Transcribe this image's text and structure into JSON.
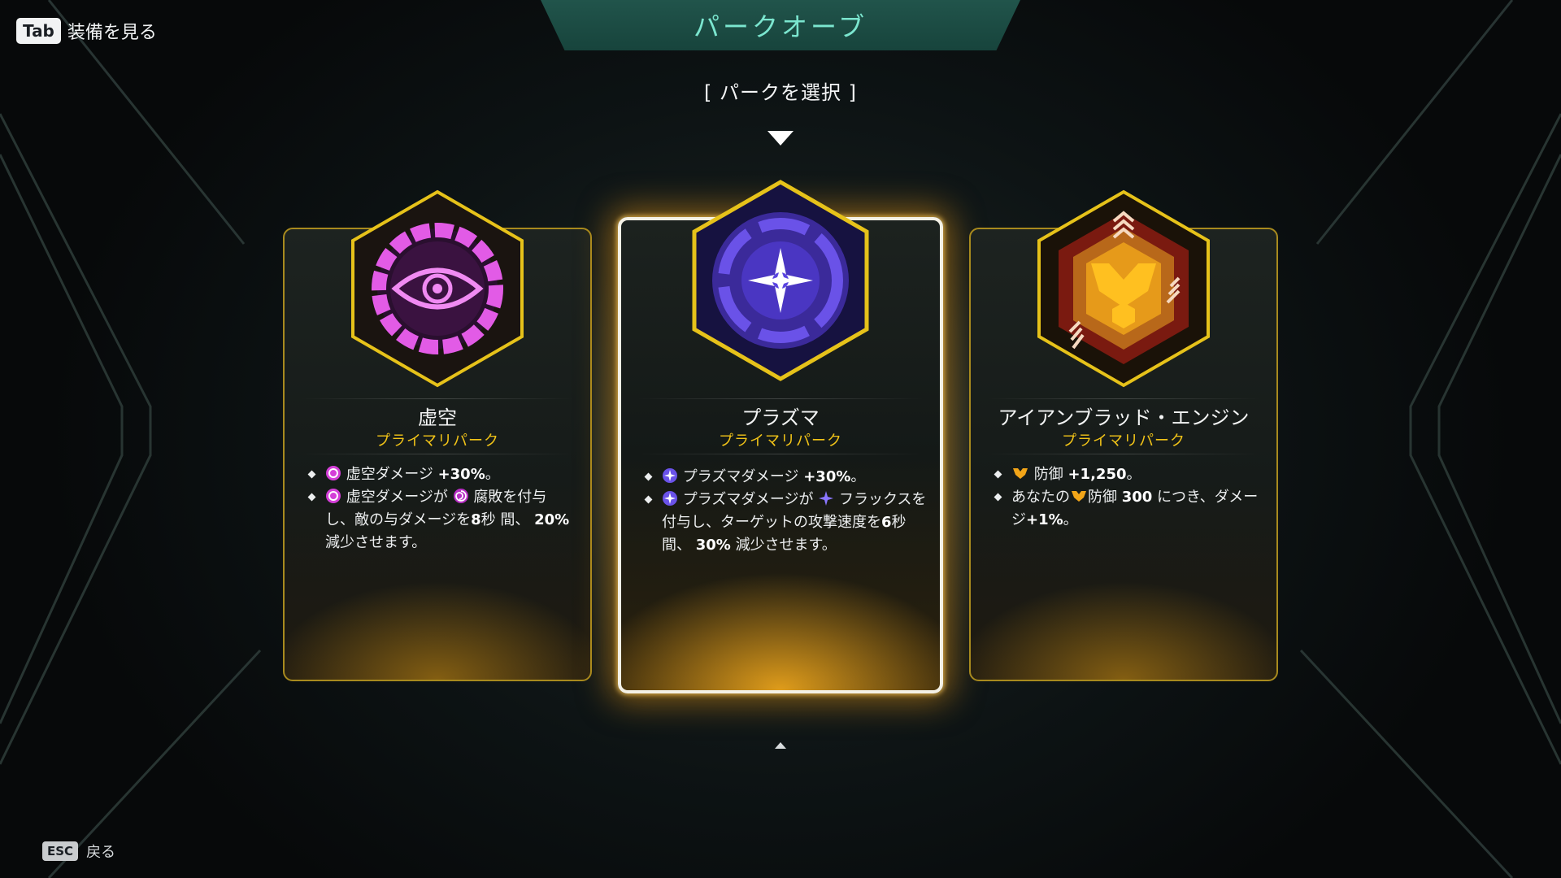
{
  "header": {
    "title": "パークオーブ",
    "select_label": "[ パークを選択 ]",
    "tab_key": "Tab",
    "tab_label": "装備を見る"
  },
  "footer": {
    "esc_key": "ESC",
    "esc_label": "戻る"
  },
  "perks": [
    {
      "name": "虚空",
      "type": "プライマリパーク",
      "icon": "void-eye-icon",
      "selected": false,
      "desc": {
        "line1_a": "虚空ダメージ",
        "line1_b": "+30%",
        "line1_c": "。",
        "line2_a": "虚空ダメージが",
        "line2_b": "腐敗を付与",
        "line2_c": "し、敵の与ダメージを",
        "line2_d": "8",
        "line2_e": "秒 間、",
        "line2_f": "20%",
        "line2_g": "減少させます。"
      }
    },
    {
      "name": "プラズマ",
      "type": "プライマリパーク",
      "icon": "plasma-star-icon",
      "selected": true,
      "desc": {
        "line1_a": "プラズマダメージ",
        "line1_b": "+30%",
        "line1_c": "。",
        "line2_a": "プラズマダメージが",
        "line2_b": "フラックスを付与し、ターゲットの攻撃速度を",
        "line2_c": "6",
        "line2_d": "秒 間、",
        "line2_e": "30%",
        "line2_f": "減少させます。"
      }
    },
    {
      "name": "アイアンブラッド・エンジン",
      "type": "プライマリパーク",
      "icon": "ironblood-engine-icon",
      "selected": false,
      "desc": {
        "line1_a": "防御",
        "line1_b": "+1,250",
        "line1_c": "。",
        "line2_a": "あなたの",
        "line2_b": "防御",
        "line2_c": "300",
        "line2_d": "につき、ダメージ",
        "line2_e": "+1%",
        "line2_f": "。"
      }
    }
  ],
  "colors": {
    "banner": "#21544b",
    "banner_text": "#7be6cf",
    "perk_type": "#f2c418",
    "frame_gold": "#e6c21a",
    "void": "#e25be6",
    "plasma": "#6a52e8"
  }
}
